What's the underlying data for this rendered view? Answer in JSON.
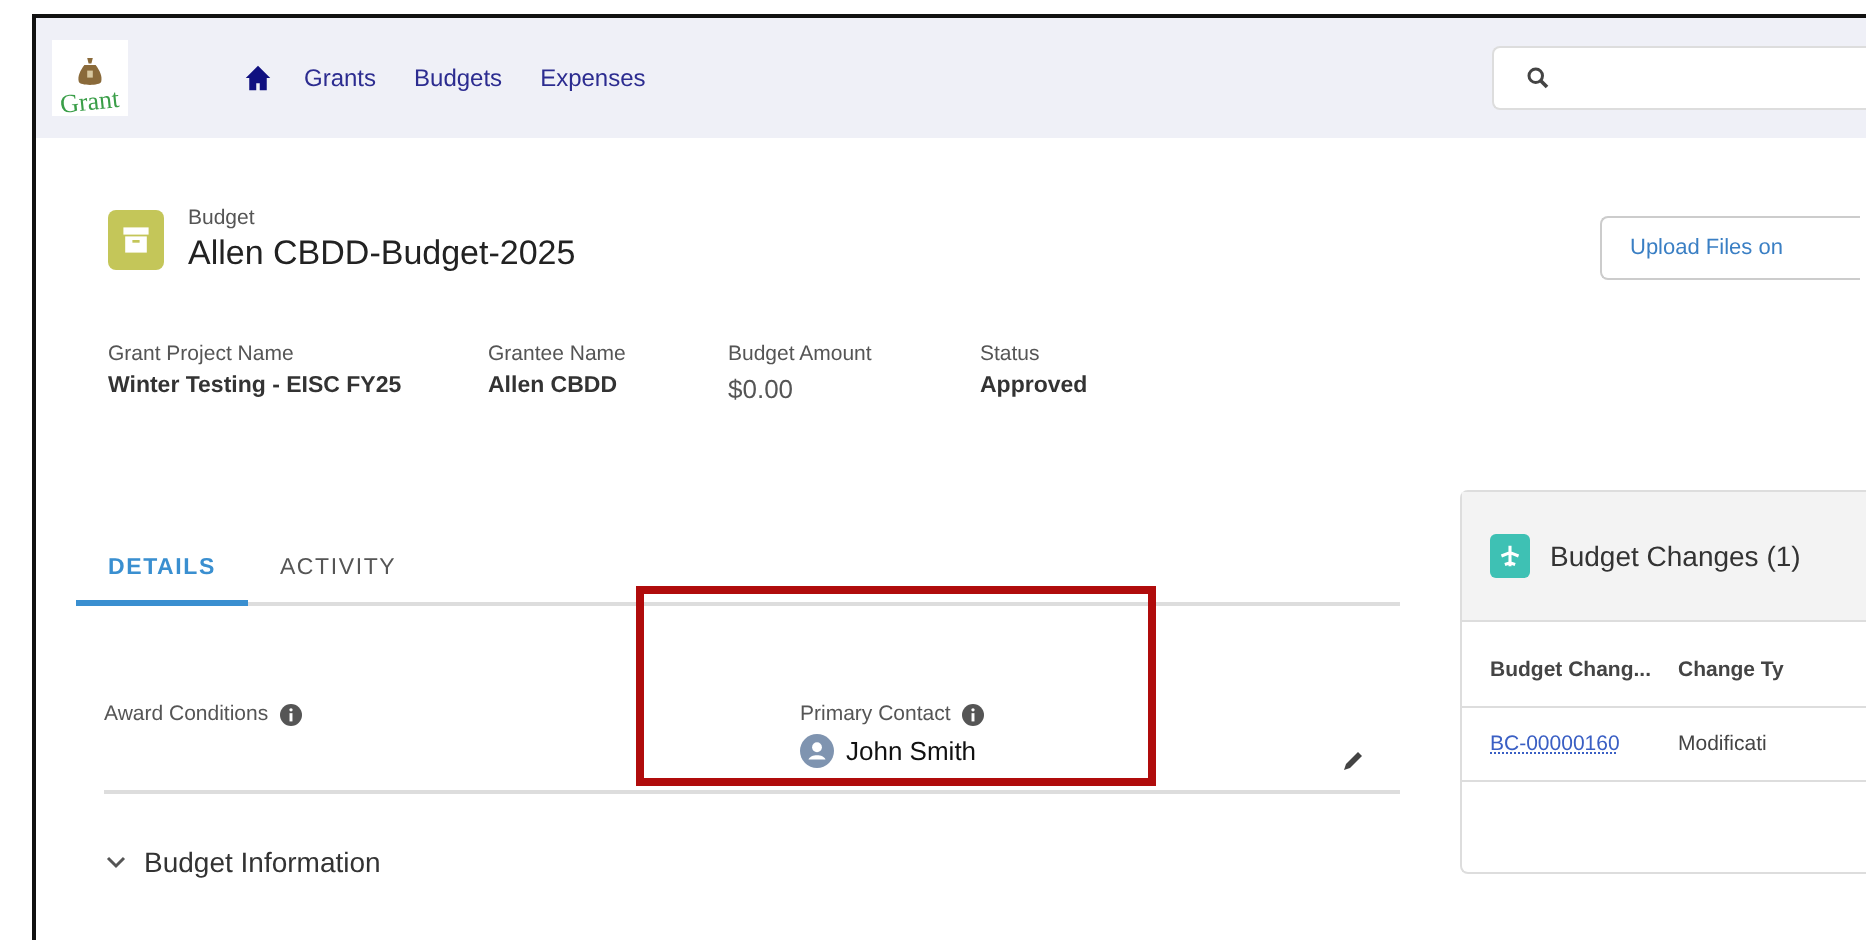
{
  "nav": {
    "logo": "Grant",
    "links": [
      "Grants",
      "Budgets",
      "Expenses"
    ]
  },
  "record": {
    "type_label": "Budget",
    "title": "Allen CBDD-Budget-2025",
    "upload_button": "Upload Files on"
  },
  "highlights": [
    {
      "label": "Grant Project Name",
      "value": "Winter Testing - EISC FY25"
    },
    {
      "label": "Grantee Name",
      "value": "Allen CBDD"
    },
    {
      "label": "Budget Amount",
      "value": "$0.00"
    },
    {
      "label": "Status",
      "value": "Approved"
    }
  ],
  "tabs": [
    {
      "label": "DETAILS",
      "selected": true
    },
    {
      "label": "ACTIVITY",
      "selected": false
    }
  ],
  "fields": [
    {
      "label": "Award Conditions",
      "info": true
    },
    {
      "label": "Primary Contact",
      "info": true,
      "value": "John Smith",
      "highlighted": true
    }
  ],
  "section": {
    "title": "Budget Information",
    "expanded": true
  },
  "related": {
    "title": "Budget Changes (1)",
    "columns": [
      "Budget Chang...",
      "Change Ty"
    ],
    "rows": [
      [
        "BC-00000160",
        "Modificati"
      ]
    ]
  }
}
